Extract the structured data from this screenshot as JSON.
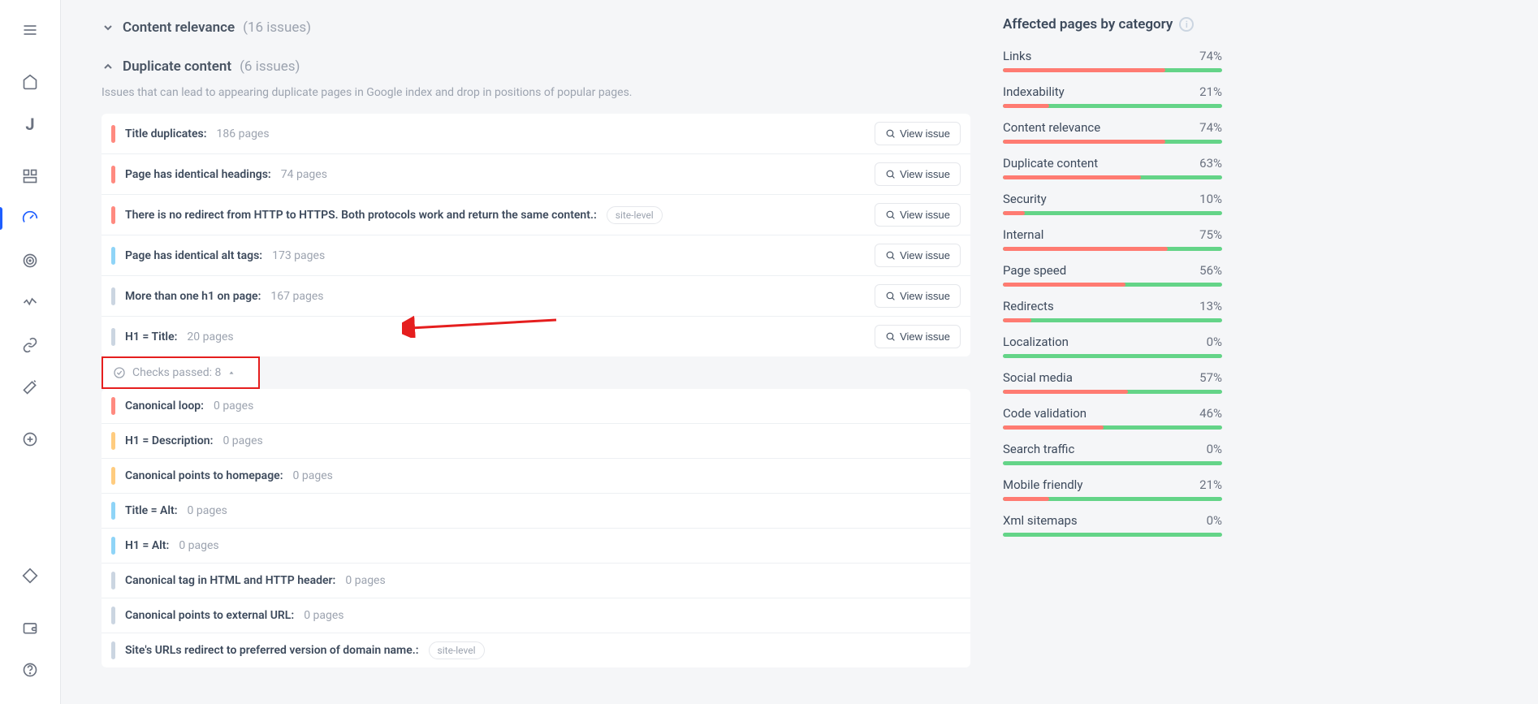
{
  "sections": {
    "content_relevance": {
      "title": "Content relevance",
      "count": "(16 issues)"
    },
    "duplicate": {
      "title": "Duplicate content",
      "count": "(6 issues)",
      "desc": "Issues that can lead to appearing duplicate pages in Google index and drop in positions of popular pages."
    }
  },
  "view_issue_label": "View issue",
  "site_level_label": "site-level",
  "checks_passed": "Checks passed: 8",
  "issues": [
    {
      "sev": "red",
      "label": "Title duplicates:",
      "pages": "186 pages",
      "view": true
    },
    {
      "sev": "red",
      "label": "Page has identical headings:",
      "pages": "74 pages",
      "view": true
    },
    {
      "sev": "red",
      "label": "There is no redirect from HTTP to HTTPS. Both protocols work and return the same content.:",
      "tag": true,
      "view": true
    },
    {
      "sev": "blue",
      "label": "Page has identical alt tags:",
      "pages": "173 pages",
      "view": true
    },
    {
      "sev": "gray",
      "label": "More than one h1 on page:",
      "pages": "167 pages",
      "view": true
    },
    {
      "sev": "gray",
      "label": "H1 = Title:",
      "pages": "20 pages",
      "view": true
    }
  ],
  "passed": [
    {
      "sev": "red",
      "label": "Canonical loop:",
      "pages": "0 pages"
    },
    {
      "sev": "orange",
      "label": "H1 = Description:",
      "pages": "0 pages"
    },
    {
      "sev": "orange",
      "label": "Canonical points to homepage:",
      "pages": "0 pages"
    },
    {
      "sev": "blue",
      "label": "Title = Alt:",
      "pages": "0 pages"
    },
    {
      "sev": "blue",
      "label": "H1 = Alt:",
      "pages": "0 pages"
    },
    {
      "sev": "gray",
      "label": "Canonical tag in HTML and HTTP header:",
      "pages": "0 pages"
    },
    {
      "sev": "gray",
      "label": "Canonical points to external URL:",
      "pages": "0 pages"
    },
    {
      "sev": "gray",
      "label": "Site's URLs redirect to preferred version of domain name.:",
      "tag": true
    }
  ],
  "right": {
    "title": "Affected pages by category",
    "categories": [
      {
        "name": "Links",
        "pct": "74%",
        "v": 74
      },
      {
        "name": "Indexability",
        "pct": "21%",
        "v": 21
      },
      {
        "name": "Content relevance",
        "pct": "74%",
        "v": 74
      },
      {
        "name": "Duplicate content",
        "pct": "63%",
        "v": 63
      },
      {
        "name": "Security",
        "pct": "10%",
        "v": 10
      },
      {
        "name": "Internal",
        "pct": "75%",
        "v": 75
      },
      {
        "name": "Page speed",
        "pct": "56%",
        "v": 56
      },
      {
        "name": "Redirects",
        "pct": "13%",
        "v": 13
      },
      {
        "name": "Localization",
        "pct": "0%",
        "v": 0
      },
      {
        "name": "Social media",
        "pct": "57%",
        "v": 57
      },
      {
        "name": "Code validation",
        "pct": "46%",
        "v": 46
      },
      {
        "name": "Search traffic",
        "pct": "0%",
        "v": 0
      },
      {
        "name": "Mobile friendly",
        "pct": "21%",
        "v": 21
      },
      {
        "name": "Xml sitemaps",
        "pct": "0%",
        "v": 0
      }
    ]
  }
}
